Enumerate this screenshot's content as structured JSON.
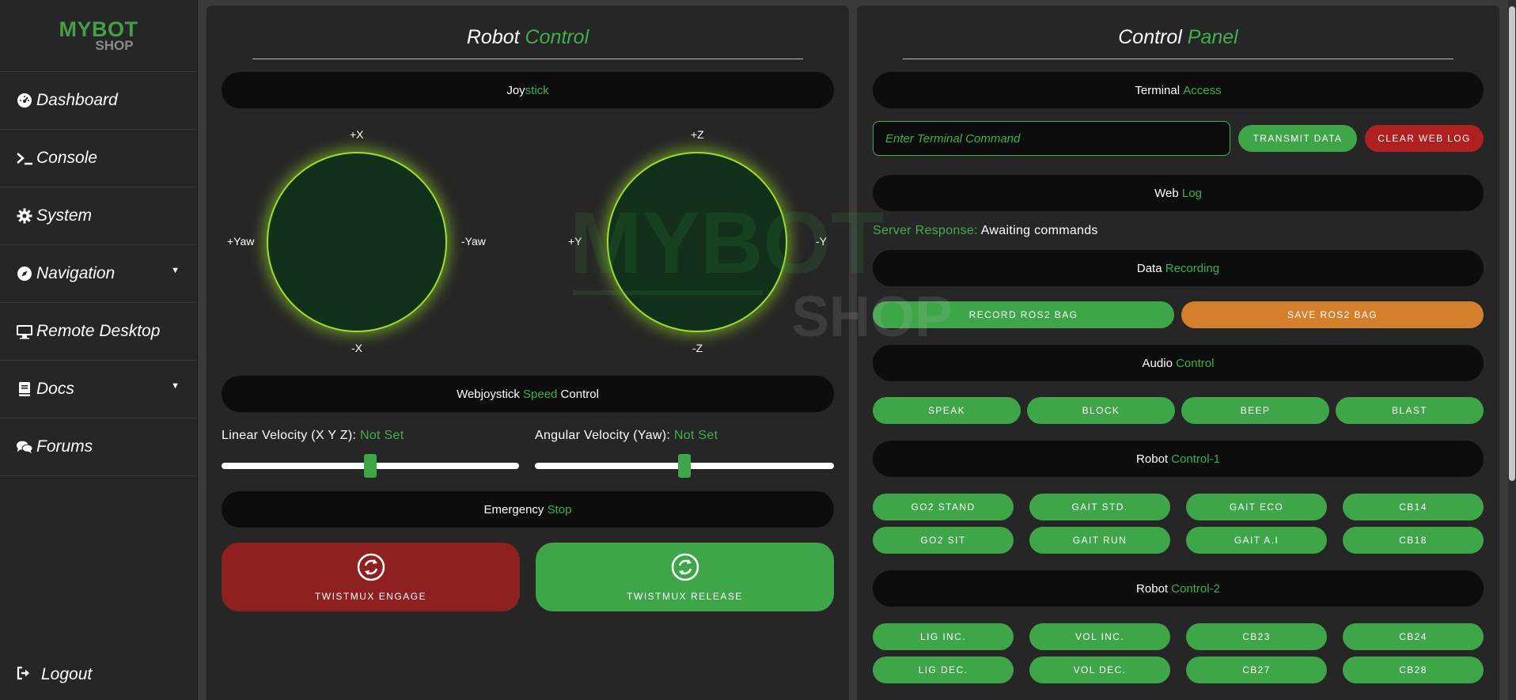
{
  "logo": {
    "line1": "MYBOT",
    "line2": "SHOP"
  },
  "sidebar": {
    "items": [
      {
        "label": "Dashboard",
        "icon": "gauge-icon"
      },
      {
        "label": "Console",
        "icon": "terminal-icon"
      },
      {
        "label": "System",
        "icon": "gear-icon"
      },
      {
        "label": "Navigation",
        "icon": "compass-icon",
        "has_caret": true
      },
      {
        "label": "Remote Desktop",
        "icon": "monitor-icon"
      },
      {
        "label": "Docs",
        "icon": "book-icon",
        "has_caret": true
      },
      {
        "label": "Forums",
        "icon": "comments-icon"
      }
    ],
    "logout": "Logout"
  },
  "robot_panel": {
    "title_a": "Robot",
    "title_b": "Control",
    "joystick_bar": {
      "a": "Joy",
      "b": "stick"
    },
    "joy_left": {
      "top": "+X",
      "bottom": "-X",
      "left": "+Yaw",
      "right": "-Yaw"
    },
    "joy_right": {
      "top": "+Z",
      "bottom": "-Z",
      "left": "+Y",
      "right": "-Y"
    },
    "speed_bar": {
      "a": "Webjoystick",
      "b": "Speed",
      "c": "Control"
    },
    "linear": {
      "label": "Linear Velocity (X Y Z):",
      "value": "Not Set",
      "level": 0.5
    },
    "angular": {
      "label": "Angular Velocity (Yaw):",
      "value": "Not Set",
      "level": 0.5
    },
    "emergency_bar": {
      "a": "Emergency",
      "b": "Stop"
    },
    "engage_label": "TWISTMUX ENGAGE",
    "release_label": "TWISTMUX RELEASE"
  },
  "control_panel": {
    "title_a": "Control",
    "title_b": "Panel",
    "terminal_bar": {
      "a": "Terminal",
      "b": "Access"
    },
    "terminal_placeholder": "Enter Terminal Command",
    "transmit_label": "TRANSMIT DATA",
    "clear_label": "CLEAR WEB LOG",
    "weblog_bar": {
      "a": "Web",
      "b": "Log"
    },
    "server_response": {
      "label": "Server Response:",
      "value": "Awaiting commands"
    },
    "data_bar": {
      "a": "Data",
      "b": "Recording"
    },
    "record_label": "RECORD ROS2 BAG",
    "save_label": "SAVE ROS2 BAG",
    "audio_bar": {
      "a": "Audio",
      "b": "Control"
    },
    "audio_buttons": [
      "SPEAK",
      "BLOCK",
      "BEEP",
      "BLAST"
    ],
    "control1_bar": {
      "a": "Robot",
      "b": "Control-1"
    },
    "control1_buttons": [
      "GO2 STAND",
      "GAIT STD.",
      "GAIT ECO",
      "CB14",
      "GO2 SIT",
      "GAIT RUN",
      "GAIT A.I",
      "CB18"
    ],
    "control2_bar": {
      "a": "Robot",
      "b": "Control-2"
    },
    "control2_buttons": [
      "LIG INC.",
      "VOL INC.",
      "CB23",
      "CB24",
      "LIG DEC.",
      "VOL DEC.",
      "CB27",
      "CB28"
    ]
  },
  "colors": {
    "accent": "#3fb04a",
    "danger": "#b02020",
    "warning": "#d47f2c",
    "engage": "#8e2020"
  }
}
